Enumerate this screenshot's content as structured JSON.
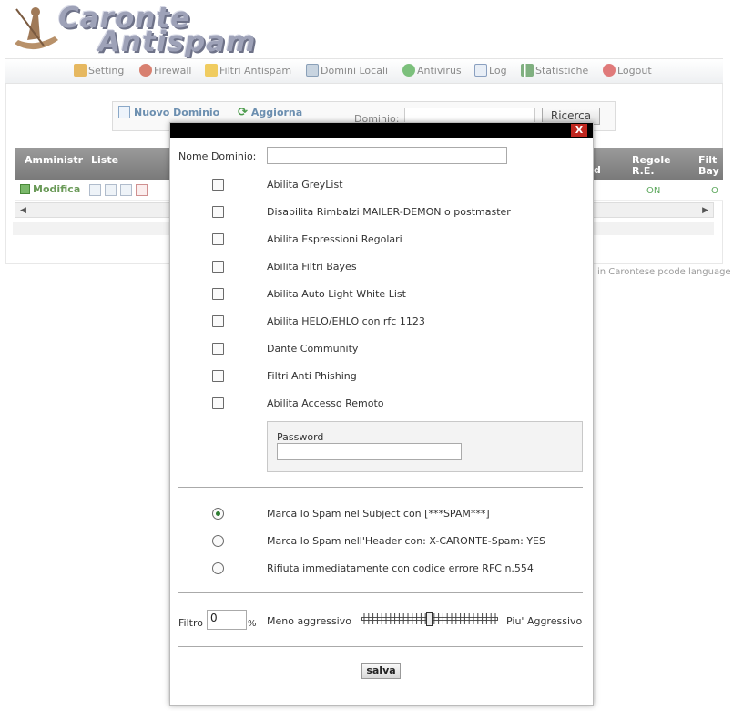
{
  "logo": {
    "line1": "Caronte",
    "line2": "Antispam"
  },
  "menu": [
    {
      "label": "Setting",
      "icon": "wrench-icon",
      "color": "#d8a040"
    },
    {
      "label": "Firewall",
      "icon": "firewall-icon",
      "color": "#c86060"
    },
    {
      "label": "Filtri Antispam",
      "icon": "shield-filter-icon",
      "color": "#e0b040"
    },
    {
      "label": "Domini Locali",
      "icon": "domains-icon",
      "color": "#7090b0"
    },
    {
      "label": "Antivirus",
      "icon": "antivirus-icon",
      "color": "#5aa05a"
    },
    {
      "label": "Log",
      "icon": "log-icon",
      "color": "#8aa0c0"
    },
    {
      "label": "Statistiche",
      "icon": "stats-icon",
      "color": "#70a070"
    },
    {
      "label": "Logout",
      "icon": "logout-icon",
      "color": "#d06060"
    }
  ],
  "toolbar": {
    "new_domain": "Nuovo Dominio",
    "refresh": "Aggiorna",
    "domain_label": "Dominio:",
    "domain_value": "",
    "search": "Ricerca"
  },
  "grid": {
    "headers": [
      "Amministr",
      "Liste",
      "d",
      "Regole R.E.",
      "Filt Bay"
    ],
    "row": {
      "edit": "Modifica",
      "regole": "ON",
      "filtri": "O"
    }
  },
  "footer": {
    "text": "in Carontese pcode language"
  },
  "modal": {
    "close": "X",
    "domain_name_label": "Nome Dominio:",
    "domain_name_value": "",
    "options": [
      {
        "label": "Abilita GreyList",
        "checked": false
      },
      {
        "label": "Disabilita Rimbalzi MAILER-DEMON o postmaster",
        "checked": false
      },
      {
        "label": "Abilita Espressioni Regolari",
        "checked": false
      },
      {
        "label": "Abilita Filtri Bayes",
        "checked": false
      },
      {
        "label": "Abilita Auto Light White List",
        "checked": false
      },
      {
        "label": "Abilita HELO/EHLO con rfc 1123",
        "checked": false
      },
      {
        "label": "Dante Community",
        "checked": false
      },
      {
        "label": "Filtri Anti Phishing",
        "checked": false
      },
      {
        "label": "Abilita Accesso Remoto",
        "checked": false
      }
    ],
    "password_label": "Password",
    "password_value": "",
    "spam_modes": [
      {
        "label": "Marca lo Spam nel Subject con [***SPAM***]",
        "selected": true
      },
      {
        "label": "Marca lo Spam nell'Header con: X-CARONTE-Spam: YES",
        "selected": false
      },
      {
        "label": "Rifiuta immediatamente con codice errore RFC n.554",
        "selected": false
      }
    ],
    "filter_label": "Filtro",
    "filter_value": "0",
    "filter_unit": "%",
    "less_aggressive": "Meno aggressivo",
    "more_aggressive": "Piu' Aggressivo",
    "slider_level": 0.5,
    "save": "salva"
  }
}
